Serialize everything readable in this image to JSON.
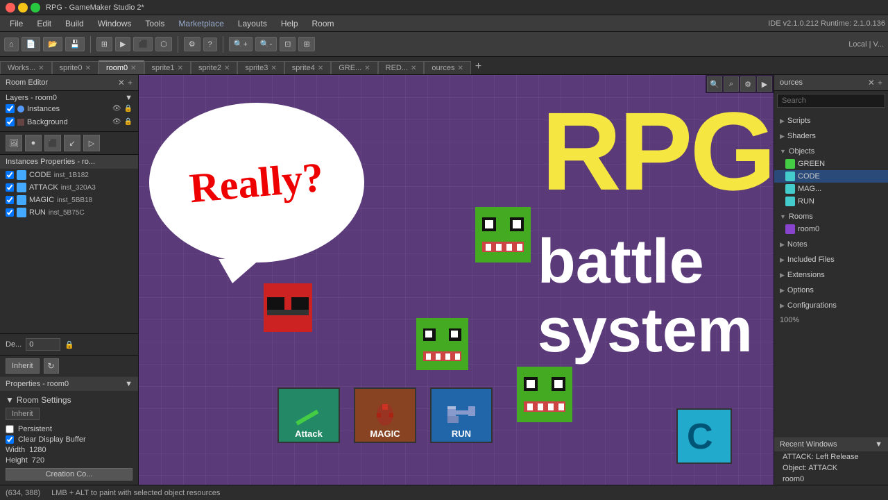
{
  "titlebar": {
    "title": "RPG - GameMaker Studio 2*",
    "controls": [
      "minimize",
      "maximize",
      "close"
    ]
  },
  "menubar": {
    "items": [
      "File",
      "Edit",
      "Build",
      "Windows",
      "Tools",
      "Marketplace",
      "Layouts",
      "Help",
      "Room"
    ],
    "ide_version": "IDE v2.1.0.212 Runtime: 2.1.0.136"
  },
  "toolbar": {
    "right_label": "Local | V..."
  },
  "tabs": [
    {
      "label": "Works...",
      "active": false,
      "closable": true
    },
    {
      "label": "sprite0",
      "active": false,
      "closable": true
    },
    {
      "label": "room0",
      "active": true,
      "closable": true
    },
    {
      "label": "sprite1",
      "active": false,
      "closable": true
    },
    {
      "label": "sprite2",
      "active": false,
      "closable": true
    },
    {
      "label": "sprite3",
      "active": false,
      "closable": true
    },
    {
      "label": "sprite4",
      "active": false,
      "closable": true
    },
    {
      "label": "GRE...",
      "active": false,
      "closable": true
    },
    {
      "label": "RED...",
      "active": false,
      "closable": true
    },
    {
      "label": "ources",
      "active": false,
      "closable": true
    }
  ],
  "left_panel": {
    "room_editor_header": "Room Editor",
    "layers_label": "Layers - room0",
    "layers": [
      {
        "name": "Instances",
        "type": "circle",
        "visible": true,
        "locked": true
      },
      {
        "name": "Background",
        "type": "image",
        "visible": true,
        "locked": true
      }
    ],
    "instances_header": "Instances Properties - ro...",
    "instances": [
      {
        "name": "CODE",
        "id": "inst_1B182",
        "checked": true
      },
      {
        "name": "ATTACK",
        "id": "inst_320A3",
        "checked": true
      },
      {
        "name": "MAGIC",
        "id": "inst_5BB18",
        "checked": true
      },
      {
        "name": "RUN",
        "id": "inst_5B75C",
        "checked": true
      }
    ],
    "depth_label": "De...",
    "depth_value": "0",
    "inherit_btn": "Inherit",
    "properties_header": "Properties - room0",
    "room_settings_label": "Room Settings",
    "inherit_btn2": "Inherit",
    "persistent_label": "Persistent",
    "persistent_checked": false,
    "clear_display_buffer_label": "Clear Display Buffer",
    "clear_display_buffer_checked": true,
    "width_label": "Width",
    "width_value": "1280",
    "height_label": "Height",
    "height_value": "720",
    "creation_code_btn": "Creation Co..."
  },
  "canvas": {
    "coords": "(634, 388)",
    "status_msg": "LMB + ALT to paint with selected object resources"
  },
  "right_panel": {
    "header": "ources",
    "search_placeholder": "Search",
    "sections": [
      {
        "label": "Scripts",
        "expanded": false,
        "items": []
      },
      {
        "label": "Shaders",
        "expanded": false,
        "items": []
      },
      {
        "label": "Objects",
        "expanded": true,
        "items": [
          {
            "name": "GREEN",
            "icon": "icon-green"
          },
          {
            "name": "CODE",
            "icon": "icon-cyan",
            "selected": true
          },
          {
            "name": "MAG...",
            "icon": "icon-cyan"
          },
          {
            "name": "RUN",
            "icon": "icon-cyan"
          }
        ]
      },
      {
        "label": "Rooms",
        "expanded": true,
        "items": [
          {
            "name": "room0",
            "icon": "icon-room"
          }
        ]
      },
      {
        "label": "Notes",
        "expanded": false,
        "items": []
      },
      {
        "label": "Included Files",
        "expanded": false,
        "items": []
      },
      {
        "label": "Extensions",
        "expanded": false,
        "items": []
      },
      {
        "label": "Options",
        "expanded": false,
        "items": []
      },
      {
        "label": "Configurations",
        "expanded": false,
        "items": []
      }
    ],
    "zoom_value": "100%",
    "recent_windows": {
      "label": "Recent Windows",
      "items": [
        {
          "label": "ATTACK: Left Release",
          "icon": "icon-blue"
        },
        {
          "label": "Object: ATTACK",
          "icon": "icon-blue"
        },
        {
          "label": "room0",
          "icon": "icon-room"
        }
      ]
    }
  },
  "sprite_labels": {
    "attack": "Attack",
    "magic": "MAGIC",
    "run": "RUN",
    "rpg": "RPG",
    "battle": "battle",
    "system": "system",
    "really": "Really?"
  }
}
